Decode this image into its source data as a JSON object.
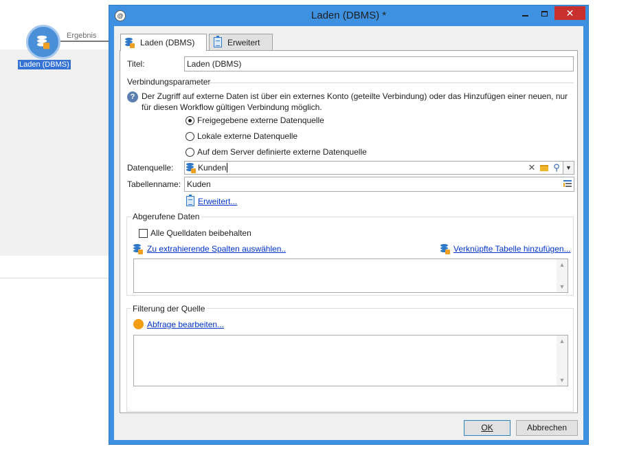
{
  "workflow": {
    "connector_label": "Ergebnis",
    "node_label": "Laden (DBMS)"
  },
  "window": {
    "title": "Laden (DBMS) *",
    "minimize_glyph": "—",
    "close_glyph": "✕"
  },
  "tabs": [
    {
      "label": "Laden (DBMS)",
      "icon": "database-load-icon",
      "active": true
    },
    {
      "label": "Erweitert",
      "icon": "clipboard-icon",
      "active": false
    }
  ],
  "form": {
    "title_label": "Titel:",
    "title_value": "Laden (DBMS)",
    "connection_section": "Verbindungsparameter",
    "help_glyph": "?",
    "info_text": "Der Zugriff auf externe Daten ist über ein externes Konto (geteilte Verbindung) oder das Hinzufügen einer neuen, nur für diesen Workflow gültigen Verbindung möglich.",
    "radio_options": [
      {
        "label": "Freigegebene externe Datenquelle",
        "checked": true
      },
      {
        "label": "Lokale externe Datenquelle",
        "checked": false
      },
      {
        "label": "Auf dem Server definierte externe Datenquelle",
        "checked": false
      }
    ],
    "datasource_label": "Datenquelle:",
    "datasource_value": "Kunden",
    "tablename_label": "Tabellenname:",
    "tablename_value": "Kuden",
    "advanced_link": "Erweitert..."
  },
  "retrieved": {
    "title": "Abgerufene Daten",
    "keep_all_label": "Alle Quelldaten beibehalten",
    "keep_all_checked": false,
    "select_columns_link": "Zu extrahierende Spalten auswählen..",
    "add_table_link": "Verknüpfte Tabelle hinzufügen..."
  },
  "filter": {
    "title": "Filterung der Quelle",
    "edit_query_link": "Abfrage bearbeiten..."
  },
  "buttons": {
    "ok": "OK",
    "cancel": "Abbrechen"
  },
  "colors": {
    "title_bar": "#3d91e0",
    "close_button": "#c7302d",
    "link": "#0033cc",
    "selection": "#3574d4"
  }
}
